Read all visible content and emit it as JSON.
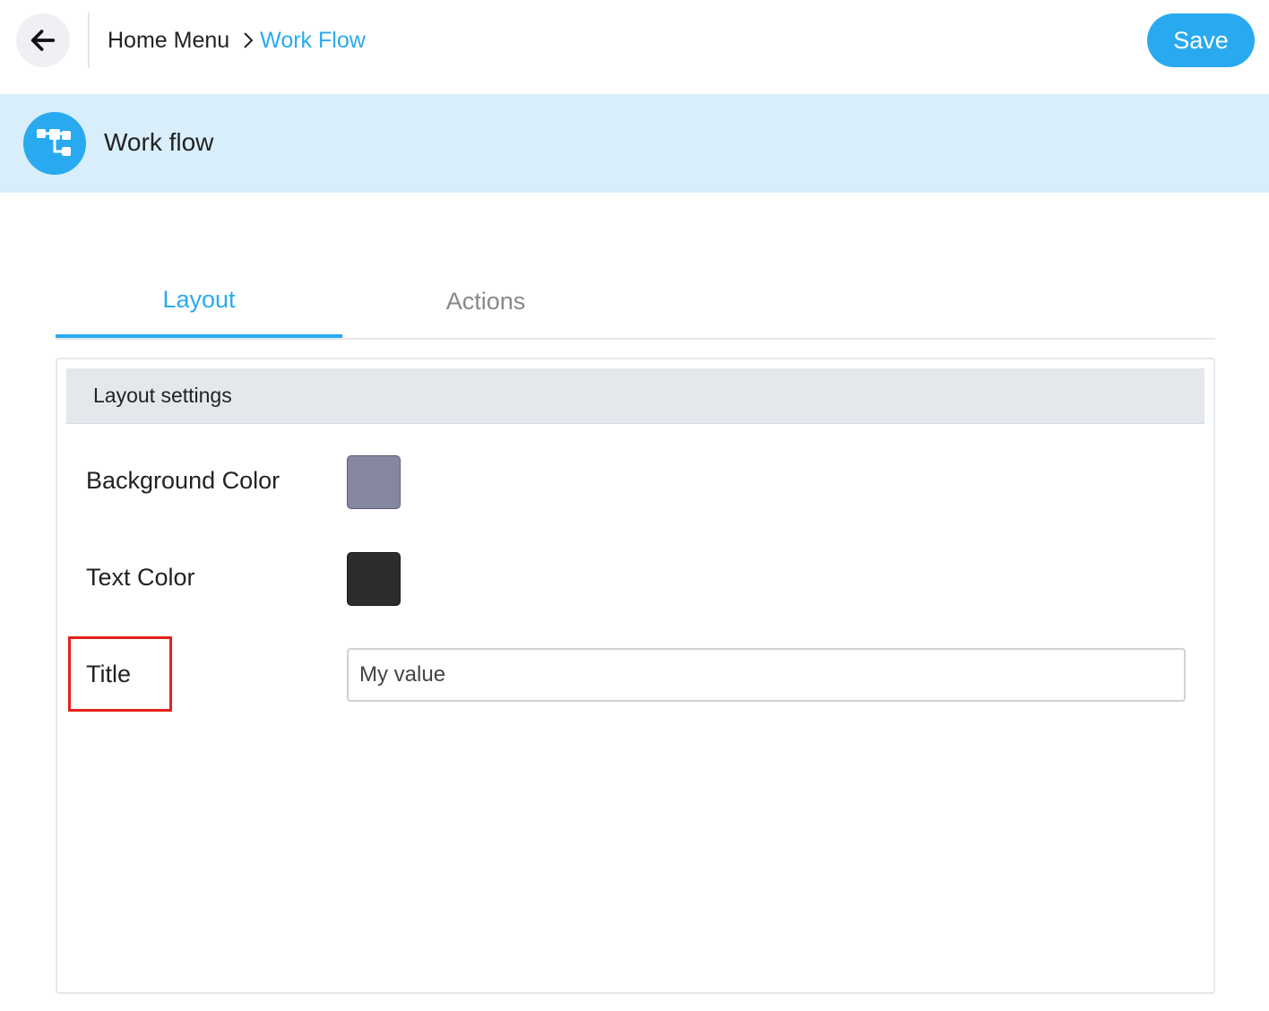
{
  "topbar": {
    "breadcrumb": {
      "home": "Home Menu",
      "current": "Work Flow"
    },
    "save_label": "Save"
  },
  "banner": {
    "title": "Work flow",
    "icon": "workflow-icon"
  },
  "tabs": [
    {
      "label": "Layout",
      "active": true
    },
    {
      "label": "Actions",
      "active": false
    }
  ],
  "panel": {
    "header": "Layout settings",
    "background_color": {
      "label": "Background Color",
      "value": "#8587a1"
    },
    "text_color": {
      "label": "Text Color",
      "value": "#2d2d2d"
    },
    "title_field": {
      "label": "Title",
      "value": "My value"
    }
  },
  "colors": {
    "accent": "#29aaf0",
    "banner_bg": "#d9eefb",
    "highlight": "#e8201c"
  }
}
